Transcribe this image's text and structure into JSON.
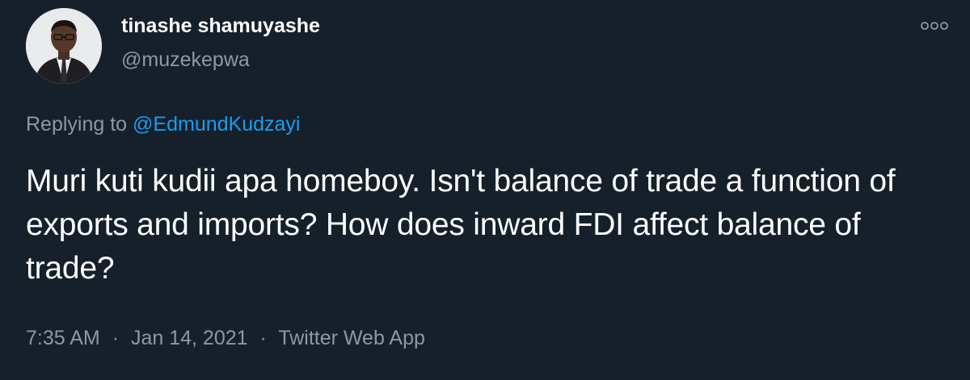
{
  "tweet": {
    "author": {
      "display_name": "tinashe shamuyashe",
      "handle": "@muzekepwa",
      "avatar_icon": "profile-photo"
    },
    "more_icon": "more-options-icon",
    "reply": {
      "prefix": "Replying to",
      "mention": "@EdmundKudzayi"
    },
    "text": "Muri kuti kudii apa homeboy. Isn't balance of trade a function of exports and imports? How does inward FDI affect balance of trade?",
    "meta": {
      "time": "7:35 AM",
      "separator": "·",
      "date": "Jan 14, 2021",
      "source": "Twitter Web App"
    }
  },
  "colors": {
    "background": "#15202b",
    "primary_text": "#ffffff",
    "secondary_text": "#8b98a5",
    "link": "#1d9bf0"
  }
}
